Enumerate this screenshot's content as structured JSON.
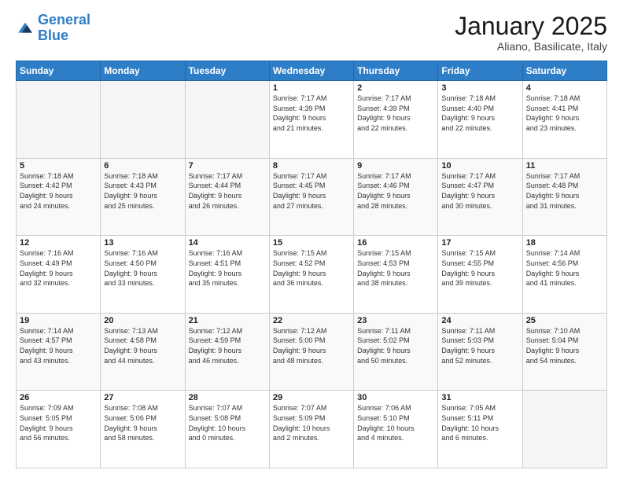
{
  "logo": {
    "line1": "General",
    "line2": "Blue"
  },
  "title": "January 2025",
  "subtitle": "Aliano, Basilicate, Italy",
  "days_header": [
    "Sunday",
    "Monday",
    "Tuesday",
    "Wednesday",
    "Thursday",
    "Friday",
    "Saturday"
  ],
  "weeks": [
    [
      {
        "day": "",
        "info": ""
      },
      {
        "day": "",
        "info": ""
      },
      {
        "day": "",
        "info": ""
      },
      {
        "day": "1",
        "info": "Sunrise: 7:17 AM\nSunset: 4:39 PM\nDaylight: 9 hours\nand 21 minutes."
      },
      {
        "day": "2",
        "info": "Sunrise: 7:17 AM\nSunset: 4:39 PM\nDaylight: 9 hours\nand 22 minutes."
      },
      {
        "day": "3",
        "info": "Sunrise: 7:18 AM\nSunset: 4:40 PM\nDaylight: 9 hours\nand 22 minutes."
      },
      {
        "day": "4",
        "info": "Sunrise: 7:18 AM\nSunset: 4:41 PM\nDaylight: 9 hours\nand 23 minutes."
      }
    ],
    [
      {
        "day": "5",
        "info": "Sunrise: 7:18 AM\nSunset: 4:42 PM\nDaylight: 9 hours\nand 24 minutes."
      },
      {
        "day": "6",
        "info": "Sunrise: 7:18 AM\nSunset: 4:43 PM\nDaylight: 9 hours\nand 25 minutes."
      },
      {
        "day": "7",
        "info": "Sunrise: 7:17 AM\nSunset: 4:44 PM\nDaylight: 9 hours\nand 26 minutes."
      },
      {
        "day": "8",
        "info": "Sunrise: 7:17 AM\nSunset: 4:45 PM\nDaylight: 9 hours\nand 27 minutes."
      },
      {
        "day": "9",
        "info": "Sunrise: 7:17 AM\nSunset: 4:46 PM\nDaylight: 9 hours\nand 28 minutes."
      },
      {
        "day": "10",
        "info": "Sunrise: 7:17 AM\nSunset: 4:47 PM\nDaylight: 9 hours\nand 30 minutes."
      },
      {
        "day": "11",
        "info": "Sunrise: 7:17 AM\nSunset: 4:48 PM\nDaylight: 9 hours\nand 31 minutes."
      }
    ],
    [
      {
        "day": "12",
        "info": "Sunrise: 7:16 AM\nSunset: 4:49 PM\nDaylight: 9 hours\nand 32 minutes."
      },
      {
        "day": "13",
        "info": "Sunrise: 7:16 AM\nSunset: 4:50 PM\nDaylight: 9 hours\nand 33 minutes."
      },
      {
        "day": "14",
        "info": "Sunrise: 7:16 AM\nSunset: 4:51 PM\nDaylight: 9 hours\nand 35 minutes."
      },
      {
        "day": "15",
        "info": "Sunrise: 7:15 AM\nSunset: 4:52 PM\nDaylight: 9 hours\nand 36 minutes."
      },
      {
        "day": "16",
        "info": "Sunrise: 7:15 AM\nSunset: 4:53 PM\nDaylight: 9 hours\nand 38 minutes."
      },
      {
        "day": "17",
        "info": "Sunrise: 7:15 AM\nSunset: 4:55 PM\nDaylight: 9 hours\nand 39 minutes."
      },
      {
        "day": "18",
        "info": "Sunrise: 7:14 AM\nSunset: 4:56 PM\nDaylight: 9 hours\nand 41 minutes."
      }
    ],
    [
      {
        "day": "19",
        "info": "Sunrise: 7:14 AM\nSunset: 4:57 PM\nDaylight: 9 hours\nand 43 minutes."
      },
      {
        "day": "20",
        "info": "Sunrise: 7:13 AM\nSunset: 4:58 PM\nDaylight: 9 hours\nand 44 minutes."
      },
      {
        "day": "21",
        "info": "Sunrise: 7:12 AM\nSunset: 4:59 PM\nDaylight: 9 hours\nand 46 minutes."
      },
      {
        "day": "22",
        "info": "Sunrise: 7:12 AM\nSunset: 5:00 PM\nDaylight: 9 hours\nand 48 minutes."
      },
      {
        "day": "23",
        "info": "Sunrise: 7:11 AM\nSunset: 5:02 PM\nDaylight: 9 hours\nand 50 minutes."
      },
      {
        "day": "24",
        "info": "Sunrise: 7:11 AM\nSunset: 5:03 PM\nDaylight: 9 hours\nand 52 minutes."
      },
      {
        "day": "25",
        "info": "Sunrise: 7:10 AM\nSunset: 5:04 PM\nDaylight: 9 hours\nand 54 minutes."
      }
    ],
    [
      {
        "day": "26",
        "info": "Sunrise: 7:09 AM\nSunset: 5:05 PM\nDaylight: 9 hours\nand 56 minutes."
      },
      {
        "day": "27",
        "info": "Sunrise: 7:08 AM\nSunset: 5:06 PM\nDaylight: 9 hours\nand 58 minutes."
      },
      {
        "day": "28",
        "info": "Sunrise: 7:07 AM\nSunset: 5:08 PM\nDaylight: 10 hours\nand 0 minutes."
      },
      {
        "day": "29",
        "info": "Sunrise: 7:07 AM\nSunset: 5:09 PM\nDaylight: 10 hours\nand 2 minutes."
      },
      {
        "day": "30",
        "info": "Sunrise: 7:06 AM\nSunset: 5:10 PM\nDaylight: 10 hours\nand 4 minutes."
      },
      {
        "day": "31",
        "info": "Sunrise: 7:05 AM\nSunset: 5:11 PM\nDaylight: 10 hours\nand 6 minutes."
      },
      {
        "day": "",
        "info": ""
      }
    ]
  ]
}
